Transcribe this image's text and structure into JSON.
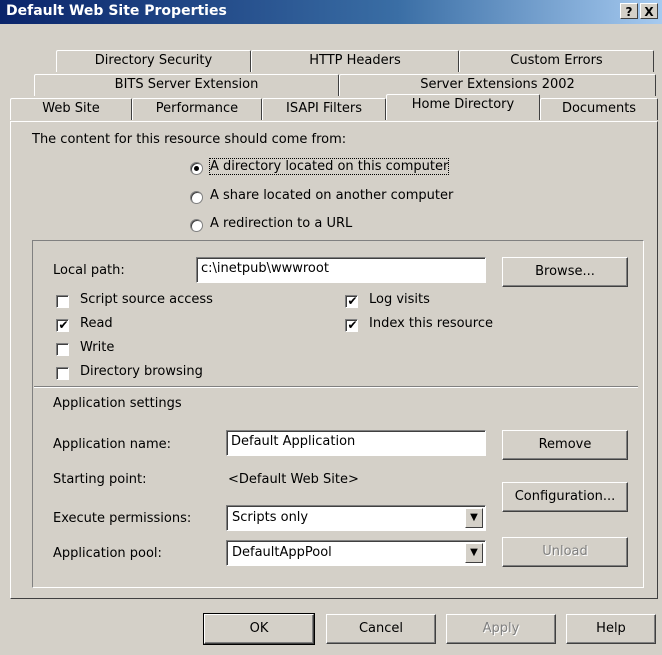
{
  "window": {
    "title": "Default Web Site Properties",
    "help_btn": "?",
    "close_btn": "X"
  },
  "tabs": {
    "row1": [
      "Directory Security",
      "HTTP Headers",
      "Custom Errors"
    ],
    "row2": [
      "BITS Server Extension",
      "Server Extensions 2002"
    ],
    "row3": [
      "Web Site",
      "Performance",
      "ISAPI Filters",
      "Home Directory",
      "Documents"
    ]
  },
  "content_source": {
    "label": "The content for this resource should come from:",
    "options": [
      "A directory located on this computer",
      "A share located on another computer",
      "A redirection to a URL"
    ],
    "selected": 0
  },
  "local_path": {
    "label": "Local path:",
    "value": "c:\\inetpub\\wwwroot",
    "browse_label": "Browse..."
  },
  "checkboxes": {
    "script_source": {
      "label": "Script source access",
      "checked": false
    },
    "read": {
      "label": "Read",
      "checked": true
    },
    "write": {
      "label": "Write",
      "checked": false
    },
    "dir_browsing": {
      "label": "Directory browsing",
      "checked": false
    },
    "log_visits": {
      "label": "Log visits",
      "checked": true
    },
    "index_resource": {
      "label": "Index this resource",
      "checked": true
    }
  },
  "check_mark": "✔",
  "app_settings": {
    "heading": "Application settings",
    "name_label": "Application name:",
    "name_value": "Default Application",
    "remove_label": "Remove",
    "start_label": "Starting point:",
    "start_value": "<Default Web Site>",
    "config_label": "Configuration...",
    "exec_label": "Execute permissions:",
    "exec_value": "Scripts only",
    "pool_label": "Application pool:",
    "pool_value": "DefaultAppPool",
    "unload_label": "Unload",
    "dropdown_arrow": "▼"
  },
  "buttons": {
    "ok": "OK",
    "cancel": "Cancel",
    "apply": "Apply",
    "help": "Help"
  }
}
